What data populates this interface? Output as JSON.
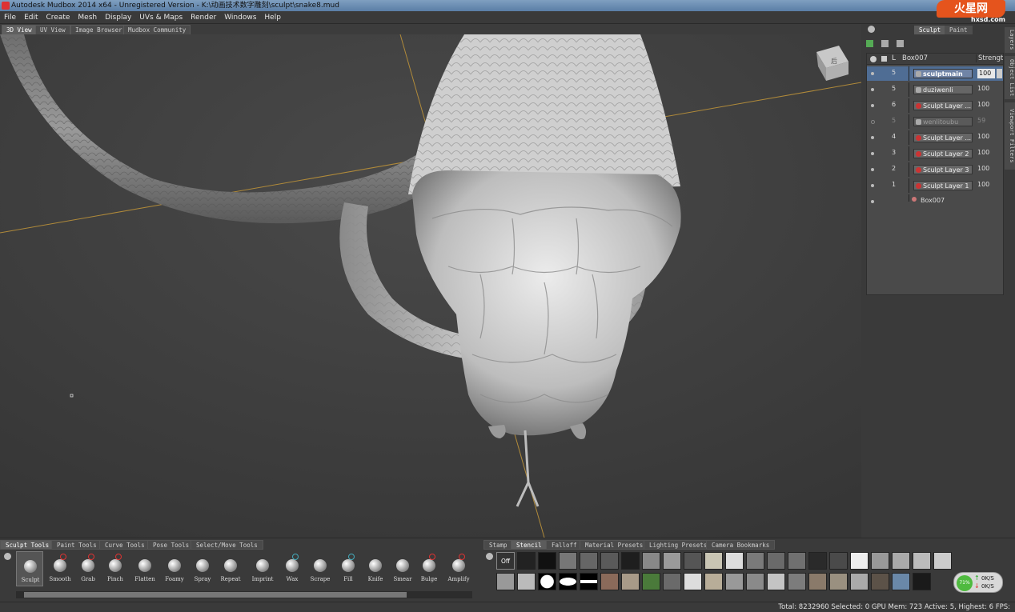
{
  "window": {
    "title": "Autodesk Mudbox 2014 x64 - Unregistered Version - K:\\动画技术数字雕刻\\sculpt\\snake8.mud",
    "watermark_main": "火星网",
    "watermark_sub": "hxsd.com"
  },
  "menu": [
    "File",
    "Edit",
    "Create",
    "Mesh",
    "Display",
    "UVs & Maps",
    "Render",
    "Windows",
    "Help"
  ],
  "viewport_tabs": [
    "3D View",
    "UV View",
    "Image Browser",
    "Mudbox Community"
  ],
  "viewcube_label": "后",
  "right_tabs": [
    "Sculpt",
    "Paint"
  ],
  "side_tabs": [
    "Layers",
    "Object List",
    "Viewport Filters"
  ],
  "layers": {
    "header_letter": "L",
    "object_name": "Box007",
    "strength_header": "Strength",
    "rows": [
      {
        "mask": "5",
        "name": "sculptmain",
        "value": "100",
        "active": true,
        "kind": "brush"
      },
      {
        "mask": "5",
        "name": "duziwenli",
        "value": "100",
        "kind": "brush"
      },
      {
        "mask": "6",
        "name": "Sculpt Layer ...",
        "value": "100",
        "kind": "sculpt"
      },
      {
        "mask": "5",
        "name": "wenlitoubu",
        "value": "59",
        "dim": true,
        "kind": "brush"
      },
      {
        "mask": "4",
        "name": "Sculpt Layer ...",
        "value": "100",
        "kind": "sculpt"
      },
      {
        "mask": "3",
        "name": "Sculpt Layer 2",
        "value": "100",
        "kind": "sculpt"
      },
      {
        "mask": "2",
        "name": "Sculpt Layer 3",
        "value": "100",
        "kind": "sculpt"
      },
      {
        "mask": "1",
        "name": "Sculpt Layer 1",
        "value": "100",
        "kind": "sculpt"
      }
    ],
    "base_mesh": "Box007"
  },
  "tray_tabs_left": [
    "Sculpt Tools",
    "Paint Tools",
    "Curve Tools",
    "Pose Tools",
    "Select/Move Tools"
  ],
  "tray_tabs_right": [
    "Stamp",
    "Stencil",
    "Falloff",
    "Material Presets",
    "Lighting Presets",
    "Camera Bookmarks"
  ],
  "tools": [
    "Sculpt",
    "Smooth",
    "Grab",
    "Pinch",
    "Flatten",
    "Foamy",
    "Spray",
    "Repeat",
    "Imprint",
    "Wax",
    "Scrape",
    "Fill",
    "Knife",
    "Smear",
    "Bulge",
    "Amplify"
  ],
  "stencil_off_label": "Off",
  "perf": {
    "percent": "71%",
    "up": "0K/S",
    "down": "0K/S"
  },
  "status": "Total: 8232960  Selected: 0  GPU Mem: 723  Active: 5, Highest: 6  FPS:",
  "colors": {
    "accent": "#4f6d94",
    "sculpt_layer_dot": "#cc3333",
    "watermark": "#e5541d"
  }
}
